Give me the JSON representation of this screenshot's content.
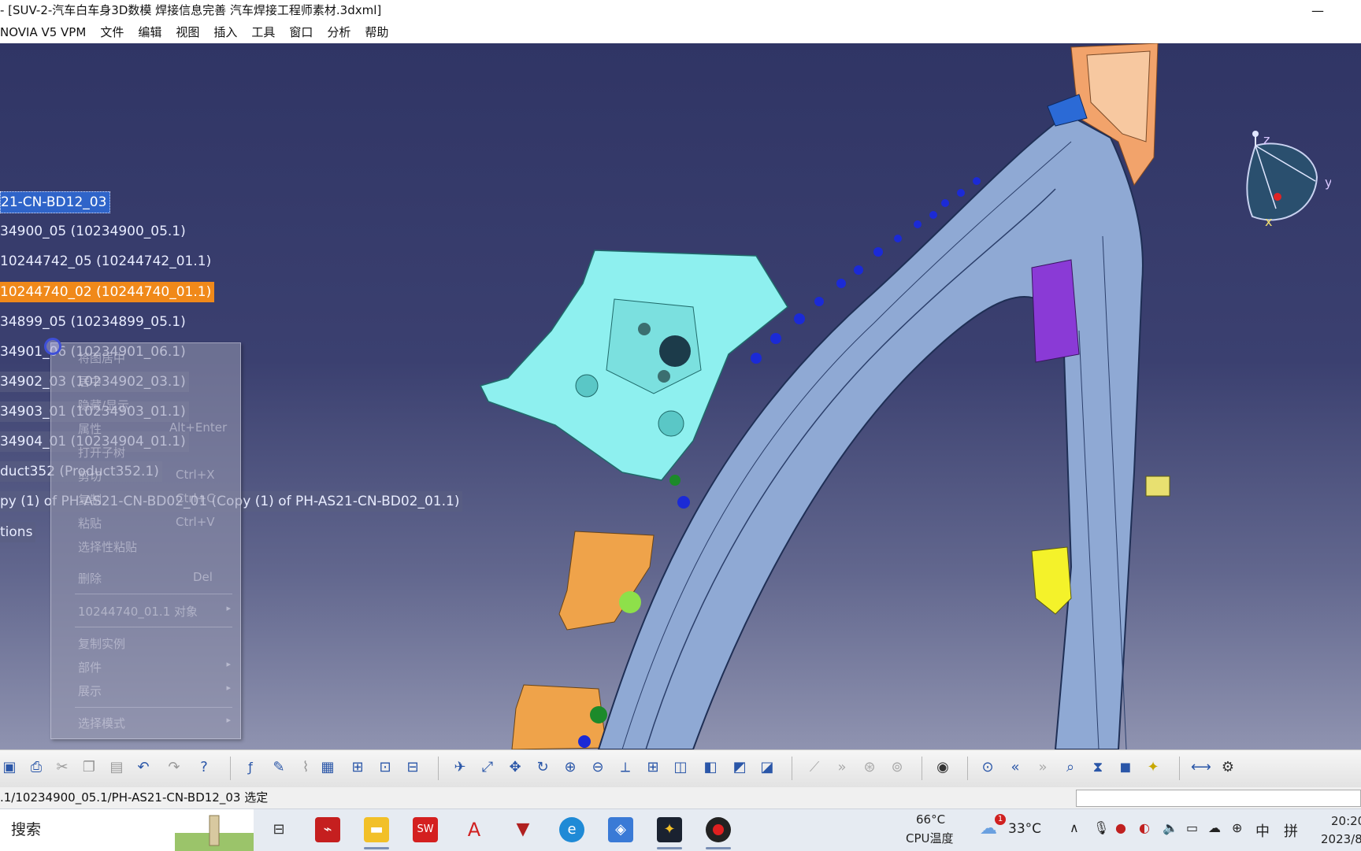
{
  "window": {
    "title": "- [SUV-2-汽车白车身3D数模 焊接信息完善 汽车焊接工程师素材.3dxml]",
    "minimize": "—"
  },
  "menubar": {
    "items": [
      "NOVIA V5 VPM",
      "文件",
      "编辑",
      "视图",
      "插入",
      "工具",
      "窗口",
      "分析",
      "帮助"
    ]
  },
  "tree": {
    "items": [
      "21-CN-BD12_03",
      "34900_05 (10234900_05.1)",
      "10244742_05 (10244742_01.1)",
      "10244740_02 (10244740_01.1)",
      "34899_05 (10234899_05.1)",
      "34901_06 (10234901_06.1)",
      "34902_03 (10234902_03.1)",
      "34903_01 (10234903_01.1)",
      "34904_01 (10234904_01.1)",
      "duct352 (Product352.1)",
      "py (1) of PH-AS21-CN-BD02_01 (Copy (1) of PH-AS21-CN-BD02_01.1)",
      "tions"
    ]
  },
  "context_menu": {
    "items": [
      "将图居中",
      "居中",
      "隐藏/显示",
      "属性",
      "打开子树",
      "剪切",
      "复制",
      "粘贴",
      "选择性粘贴",
      "删除",
      "10244740_01.1 对象",
      "复制实例",
      "部件",
      "展示",
      "选择模式"
    ],
    "shortcuts": {
      "properties": "Alt+Enter",
      "cut": "Ctrl+X",
      "copy": "Ctrl+C",
      "paste": "Ctrl+V",
      "delete": "Del"
    }
  },
  "compass": {
    "z": "z",
    "y": "y",
    "x": "x"
  },
  "toolbar": {
    "icons": [
      "save-icon",
      "print-icon",
      "cut-icon",
      "copy-icon",
      "paste-icon",
      "undo-icon",
      "redo-icon",
      "whats-this-icon",
      "formula-icon",
      "comment-icon",
      "ruler-icon",
      "table-icon",
      "tree-icon",
      "lock-icon",
      "split-icon",
      "fly-icon",
      "fit-all-icon",
      "pan-icon",
      "rotate-icon",
      "zoom-in-icon",
      "zoom-out-icon",
      "normal-view-icon",
      "multi-view-icon",
      "iso-view-icon",
      "shading-icon",
      "hide-icon",
      "swap-icon",
      "snap-icon",
      "next-icon",
      "attach-icon",
      "detach-icon",
      "camera-icon",
      "target-icon",
      "first-icon",
      "last-icon",
      "search-icon",
      "filter-icon",
      "color-icon",
      "light-icon",
      "measure-icon",
      "tools-icon"
    ]
  },
  "statusbar": {
    "text": ".1/10234900_05.1/PH-AS21-CN-BD12_03 选定"
  },
  "taskbar": {
    "search": "搜索",
    "cpu_temp": "66°C",
    "cpu_label": "CPU温度",
    "weather": "33°C",
    "weather_badge": "1",
    "ime1": "中",
    "ime2": "拼",
    "time": "20:20",
    "date": "2023/8"
  },
  "colors": {
    "viewport_top": "#303565",
    "selection_orange": "#f0891a",
    "selection_blue": "#2f64c9"
  }
}
